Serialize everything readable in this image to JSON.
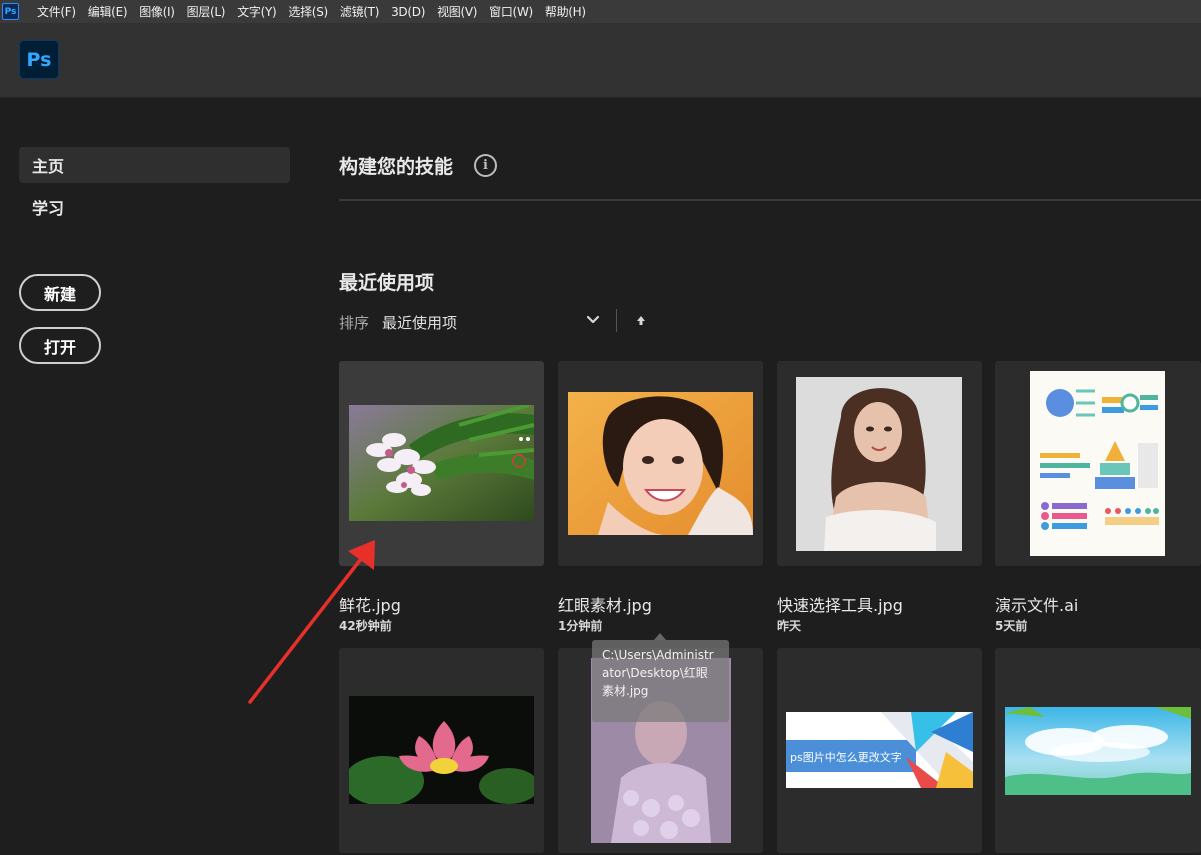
{
  "app": {
    "logo_mini": "Ps",
    "logo": "Ps"
  },
  "menu": [
    "文件(F)",
    "编辑(E)",
    "图像(I)",
    "图层(L)",
    "文字(Y)",
    "选择(S)",
    "滤镜(T)",
    "3D(D)",
    "视图(V)",
    "窗口(W)",
    "帮助(H)"
  ],
  "sidebar": {
    "items": [
      {
        "label": "主页",
        "active": true
      },
      {
        "label": "学习",
        "active": false
      }
    ],
    "new_button": "新建",
    "open_button": "打开"
  },
  "main": {
    "skills_title": "构建您的技能",
    "info_icon": "i",
    "recent_title": "最近使用项",
    "sort_label": "排序",
    "sort_value": "最近使用项",
    "files": [
      {
        "name": "鲜花.jpg",
        "time": "42秒钟前",
        "icon": "flower-image"
      },
      {
        "name": "红眼素材.jpg",
        "time": "1分钟前",
        "icon": "portrait-smiling-image"
      },
      {
        "name": "快速选择工具.jpg",
        "time": "昨天",
        "icon": "portrait-woman-image"
      },
      {
        "name": "演示文件.ai",
        "time": "5天前",
        "icon": "infographic-image"
      },
      {
        "icon": "lotus-image"
      },
      {
        "icon": "portrait-faded-image"
      },
      {
        "banner_text": "ps图片中怎么更改文字",
        "icon": "banner-image"
      },
      {
        "icon": "sky-landscape-image"
      }
    ],
    "tooltip": "C:\\Users\\Administrator\\Desktop\\红眼素材.jpg"
  },
  "colors": {
    "background": "#1e1e1e",
    "header": "#323232",
    "menubar": "#3a3a3a",
    "ps_blue": "#31a8ff",
    "ps_dark": "#001e36",
    "annotation": "#e8302a"
  }
}
